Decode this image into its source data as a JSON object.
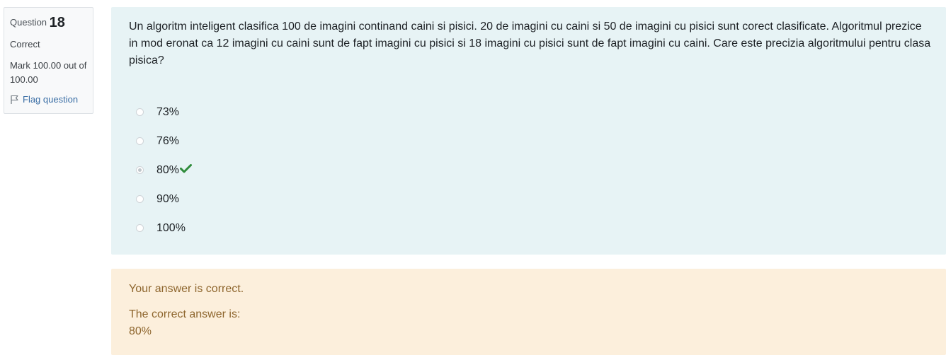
{
  "info": {
    "question_label": "Question",
    "question_number": "18",
    "state": "Correct",
    "grade": "Mark 100.00 out of 100.00",
    "flag_label": "Flag question",
    "flag_icon": "flag-icon"
  },
  "question": {
    "text": "Un algoritm inteligent clasifica 100 de imagini continand caini si pisici. 20 de imagini cu caini si 50 de imagini cu pisici sunt corect clasificate. Algoritmul prezice in mod eronat ca 12 imagini cu caini sunt de fapt imagini cu pisici si 18 imagini cu pisici sunt de fapt imagini cu caini. Care este precizia algoritmului pentru clasa pisica?",
    "options": [
      {
        "label": "73%",
        "selected": false
      },
      {
        "label": "76%",
        "selected": false
      },
      {
        "label": "80%",
        "selected": true,
        "correct_mark_icon": "checkmark-icon"
      },
      {
        "label": "90%",
        "selected": false
      },
      {
        "label": "100%",
        "selected": false
      }
    ]
  },
  "feedback": {
    "general": "Your answer is correct.",
    "right_answer_label": "The correct answer is:",
    "right_answer_value": "80%"
  },
  "colors": {
    "question_bg": "#e7f3f5",
    "feedback_bg": "#fcefdc",
    "feedback_text": "#8e662e",
    "check_green": "#2e8b3a",
    "link_blue": "#3a6ea5"
  }
}
